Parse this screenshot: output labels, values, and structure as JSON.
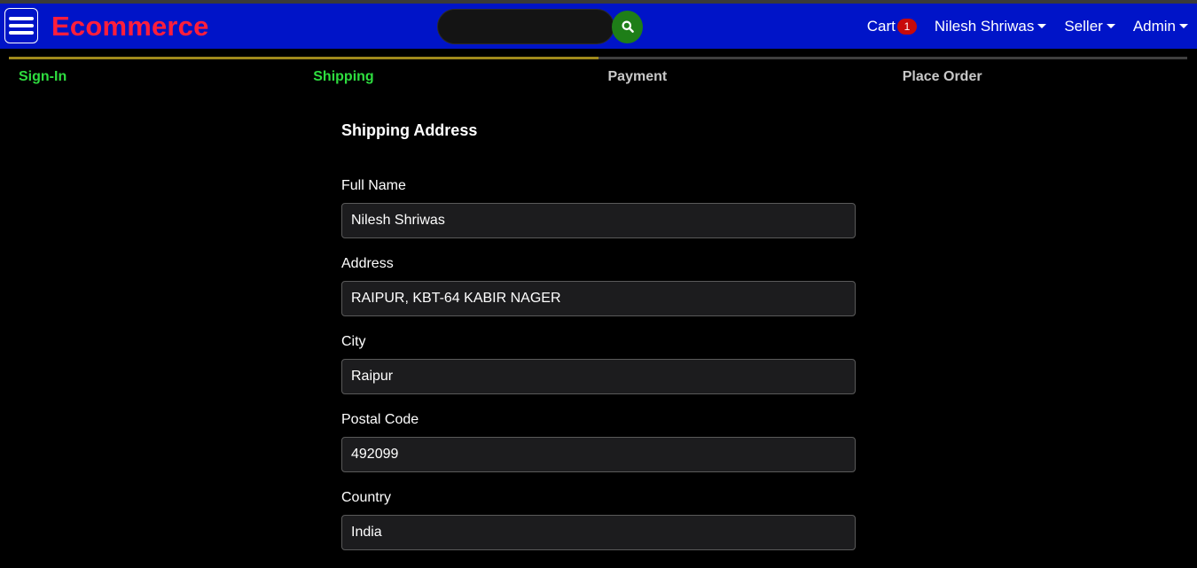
{
  "header": {
    "brand": "Ecommerce",
    "search": {
      "value": "",
      "placeholder": ""
    },
    "cart": {
      "label": "Cart",
      "count": "1"
    },
    "user_menu": "Nilesh Shriwas",
    "seller_menu": "Seller",
    "admin_menu": "Admin"
  },
  "steps": [
    {
      "label": "Sign-In",
      "active": true
    },
    {
      "label": "Shipping",
      "active": true
    },
    {
      "label": "Payment",
      "active": false
    },
    {
      "label": "Place Order",
      "active": false
    }
  ],
  "form": {
    "title": "Shipping Address",
    "fields": [
      {
        "label": "Full Name",
        "value": "Nilesh Shriwas"
      },
      {
        "label": "Address",
        "value": "RAIPUR, KBT-64 KABIR NAGER"
      },
      {
        "label": "City",
        "value": "Raipur"
      },
      {
        "label": "Postal Code",
        "value": "492099"
      },
      {
        "label": "Country",
        "value": "India"
      }
    ]
  },
  "colors": {
    "header_bg": "#0014c8",
    "brand": "#ff1e3c",
    "step_active_text": "#2edd3f",
    "step_active_bar": "#a08a1c",
    "search_button": "#1e7e18",
    "cart_badge": "#c80a0a"
  },
  "icons": {
    "menu": "hamburger-icon",
    "search": "search-icon",
    "dropdown": "caret-down-icon"
  }
}
